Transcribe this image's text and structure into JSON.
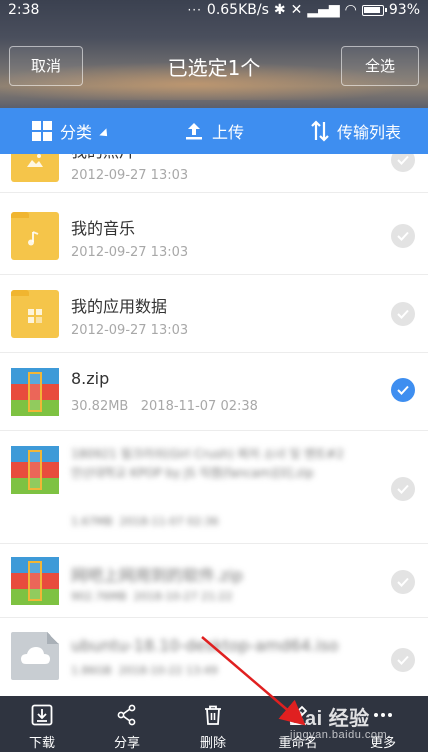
{
  "status_bar": {
    "time": "2:38",
    "network_speed": "0.65KB/s",
    "battery": "93%"
  },
  "header": {
    "cancel_label": "取消",
    "title": "已选定1个",
    "select_all_label": "全选"
  },
  "toolbar": {
    "classify_label": "分类",
    "upload_label": "上传",
    "transfer_label": "传输列表"
  },
  "files": [
    {
      "name": "我的照片",
      "date": "2012-09-27  13:03",
      "size": "",
      "icon": "image-folder-icon",
      "checked": false
    },
    {
      "name": "我的音乐",
      "date": "2012-09-27  13:03",
      "size": "",
      "icon": "music-folder-icon",
      "checked": false
    },
    {
      "name": "我的应用数据",
      "date": "2012-09-27  13:03",
      "size": "",
      "icon": "app-folder-icon",
      "checked": false
    },
    {
      "name": "8.zip",
      "date": "2018-11-07  02:38",
      "size": "30.82MB",
      "icon": "zip-file-icon",
      "checked": true
    },
    {
      "name": "180921 필크러쉬(Girl Crush) 찌저 소녀 및 멘트#2 안산대학교 KPOP by JS 직캠(fancam)[0].zip",
      "date": "2018-11-07  02:36",
      "size": "1.67MB",
      "icon": "zip-file-icon",
      "checked": false
    },
    {
      "name": "网吧上网用到的软件.zip",
      "date": "2018-10-27  21:22",
      "size": "902.76MB",
      "icon": "zip-file-icon",
      "checked": false
    },
    {
      "name": "ubuntu-18.10-desktop-amd64.iso",
      "date": "2018-10-22  13:49",
      "size": "1.86GB",
      "icon": "iso-file-icon",
      "checked": false
    }
  ],
  "bottom_bar": {
    "download_label": "下载",
    "share_label": "分享",
    "delete_label": "删除",
    "rename_label": "重命名",
    "more_label": "更多"
  },
  "watermark": {
    "brand": "Bai 经验",
    "url": "jingyan.baidu.com"
  },
  "colors": {
    "accent_blue": "#3e8ef0",
    "bottom_bar": "#2f3440",
    "folder_yellow": "#f5c54a"
  }
}
